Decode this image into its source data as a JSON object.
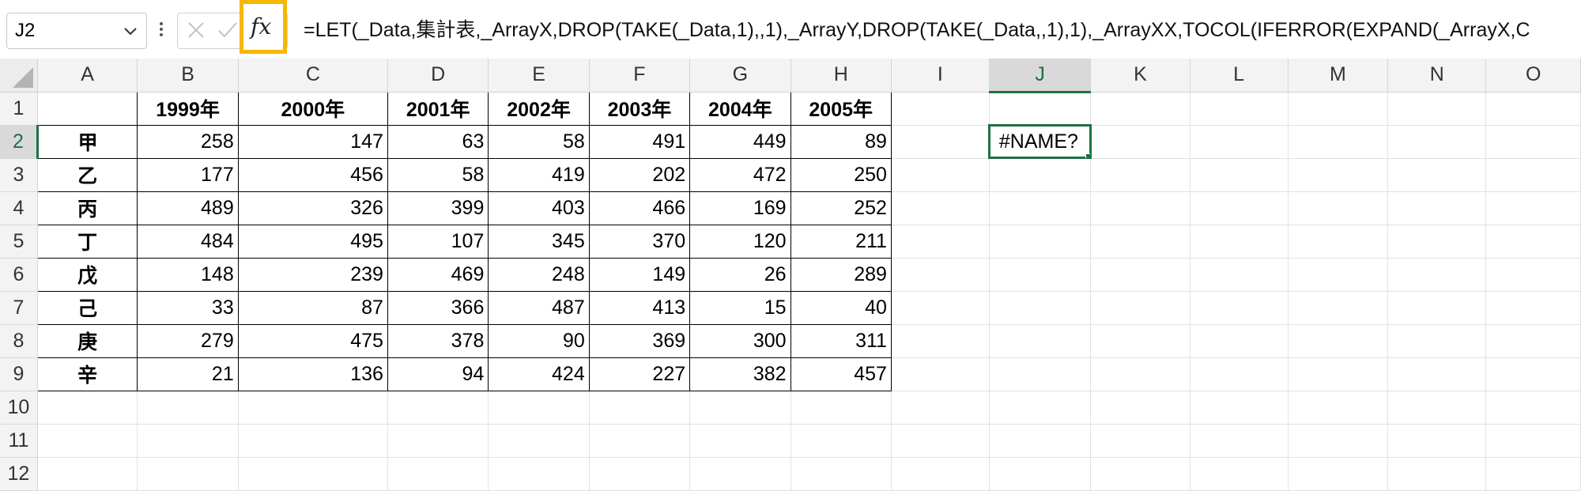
{
  "formula_bar": {
    "name_box": "J2",
    "fx_label": "fx",
    "formula": "=LET(_Data,集計表,_ArrayX,DROP(TAKE(_Data,1),,1),_ArrayY,DROP(TAKE(_Data,,1),1),_ArrayXX,TOCOL(IFERROR(EXPAND(_ArrayX,C"
  },
  "grid": {
    "columns": [
      "A",
      "B",
      "C",
      "D",
      "E",
      "F",
      "G",
      "H",
      "I",
      "J",
      "K",
      "L",
      "M",
      "N",
      "O"
    ],
    "selected_column": "J",
    "selected_row": "2",
    "rows": [
      {
        "num": "1",
        "cells": [
          "",
          "1999年",
          "2000年",
          "2001年",
          "2002年",
          "2003年",
          "2004年",
          "2005年",
          "",
          "",
          "",
          "",
          "",
          "",
          ""
        ]
      },
      {
        "num": "2",
        "cells": [
          "甲",
          "258",
          "147",
          "63",
          "58",
          "491",
          "449",
          "89",
          "",
          "#NAME?",
          "",
          "",
          "",
          "",
          ""
        ]
      },
      {
        "num": "3",
        "cells": [
          "乙",
          "177",
          "456",
          "58",
          "419",
          "202",
          "472",
          "250",
          "",
          "",
          "",
          "",
          "",
          "",
          ""
        ]
      },
      {
        "num": "4",
        "cells": [
          "丙",
          "489",
          "326",
          "399",
          "403",
          "466",
          "169",
          "252",
          "",
          "",
          "",
          "",
          "",
          "",
          ""
        ]
      },
      {
        "num": "5",
        "cells": [
          "丁",
          "484",
          "495",
          "107",
          "345",
          "370",
          "120",
          "211",
          "",
          "",
          "",
          "",
          "",
          "",
          ""
        ]
      },
      {
        "num": "6",
        "cells": [
          "戊",
          "148",
          "239",
          "469",
          "248",
          "149",
          "26",
          "289",
          "",
          "",
          "",
          "",
          "",
          "",
          ""
        ]
      },
      {
        "num": "7",
        "cells": [
          "己",
          "33",
          "87",
          "366",
          "487",
          "413",
          "15",
          "40",
          "",
          "",
          "",
          "",
          "",
          "",
          ""
        ]
      },
      {
        "num": "8",
        "cells": [
          "庚",
          "279",
          "475",
          "378",
          "90",
          "369",
          "300",
          "311",
          "",
          "",
          "",
          "",
          "",
          "",
          ""
        ]
      },
      {
        "num": "9",
        "cells": [
          "辛",
          "21",
          "136",
          "94",
          "424",
          "227",
          "382",
          "457",
          "",
          "",
          "",
          "",
          "",
          "",
          ""
        ]
      },
      {
        "num": "10",
        "cells": [
          "",
          "",
          "",
          "",
          "",
          "",
          "",
          "",
          "",
          "",
          "",
          "",
          "",
          "",
          ""
        ]
      },
      {
        "num": "11",
        "cells": [
          "",
          "",
          "",
          "",
          "",
          "",
          "",
          "",
          "",
          "",
          "",
          "",
          "",
          "",
          ""
        ]
      },
      {
        "num": "12",
        "cells": [
          "",
          "",
          "",
          "",
          "",
          "",
          "",
          "",
          "",
          "",
          "",
          "",
          "",
          "",
          ""
        ]
      }
    ]
  },
  "colors": {
    "accent_green": "#1e7145",
    "fx_highlight": "#f5b800"
  }
}
